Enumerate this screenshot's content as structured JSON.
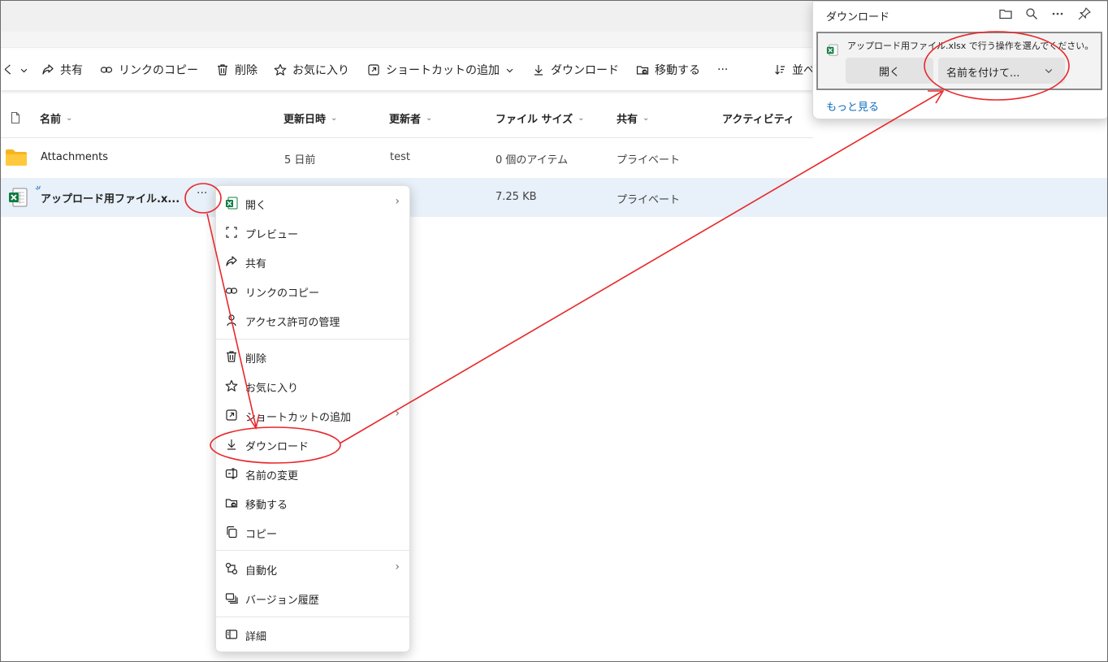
{
  "toolbar": {
    "overflow_left": "く",
    "share": "共有",
    "copy_link": "リンクのコピー",
    "delete": "削除",
    "favorite": "お気に入り",
    "add_shortcut": "ショートカットの追加",
    "download": "ダウンロード",
    "move_to": "移動する",
    "more": "···",
    "sort": "並べ"
  },
  "columns": {
    "name": "名前",
    "modified": "更新日時",
    "modified_by": "更新者",
    "file_size": "ファイル サイズ",
    "sharing": "共有",
    "activity": "アクティビティ"
  },
  "rows": [
    {
      "name": "Attachments",
      "modified": "5 日前",
      "modified_by": "test",
      "size": "0 個のアイテム",
      "sharing": "プライベート"
    },
    {
      "name": "アップロード用ファイル.x...",
      "size": "7.25 KB",
      "sharing": "プライベート"
    }
  ],
  "context_menu": {
    "open": "開く",
    "preview": "プレビュー",
    "share": "共有",
    "copy_link": "リンクのコピー",
    "manage_access": "アクセス許可の管理",
    "delete": "削除",
    "favorite": "お気に入り",
    "add_shortcut": "ショートカットの追加",
    "download": "ダウンロード",
    "rename": "名前の変更",
    "move_to": "移動する",
    "copy": "コピー",
    "automate": "自動化",
    "version_history": "バージョン履歴",
    "details": "詳細"
  },
  "download_panel": {
    "title": "ダウンロード",
    "message": "アップロード用ファイル.xlsx で行う操作を選んでください。",
    "open": "開く",
    "save_as": "名前を付けて...",
    "more": "もっと見る"
  },
  "colors": {
    "selected_row": "#e8f0f9",
    "annotation": "#e8272a",
    "excel_green": "#107c41",
    "folder_yellow": "#f5b51c",
    "link_blue": "#0f6cbd"
  }
}
